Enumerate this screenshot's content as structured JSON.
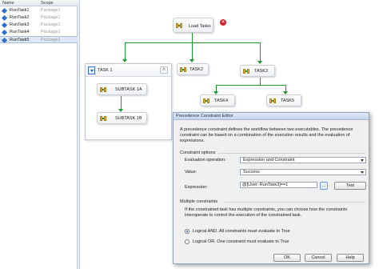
{
  "variables": {
    "columns": {
      "name": "Name",
      "scope": "Scope"
    },
    "rows": [
      {
        "name": "RunTask1",
        "scope": "Package1"
      },
      {
        "name": "RunTask2",
        "scope": "Package1"
      },
      {
        "name": "RunTask3",
        "scope": "Package1"
      },
      {
        "name": "RunTask4",
        "scope": "Package1"
      },
      {
        "name": "RunTask5",
        "scope": "Package1"
      }
    ]
  },
  "canvas": {
    "load_tasks": "Load Tasks",
    "container_title": "TASK 1",
    "subtask_1a": "SUBTASK 1A",
    "subtask_1b": "SUBTASK 1B",
    "task2": "TASK2",
    "task3": "TASK3",
    "task4": "TASK4",
    "task5": "TASK5",
    "collapse_glyph": "˄",
    "error_glyph": "✕"
  },
  "dialog": {
    "title": "Precedence Constraint Editor",
    "description": "A precedence constraint defines the workflow between two executables. The precedence constraint can be based on a combination of the execution results and the evaluation of expressions.",
    "constraint_options_label": "Constraint options",
    "evaluation_operation_label": "Evaluation operation:",
    "evaluation_operation_value": "Expression and Constraint",
    "value_label": "Value:",
    "value_value": "Success",
    "expression_label": "Expression:",
    "expression_value": "@[User::RunTask3]==1",
    "ellipsis_label": "...",
    "test_label": "Test",
    "multiple_constraints_label": "Multiple constraints",
    "multiple_desc": "If the constrained task has multiple constraints, you can choose how the constraints interoperate to control the execution of the constrained task.",
    "logical_and_label": "Logical AND. All constraints must evaluate to True",
    "logical_or_label": "Logical OR. One constraint must evaluate to True",
    "ok_label": "OK",
    "cancel_label": "Cancel",
    "help_label": "Help"
  }
}
